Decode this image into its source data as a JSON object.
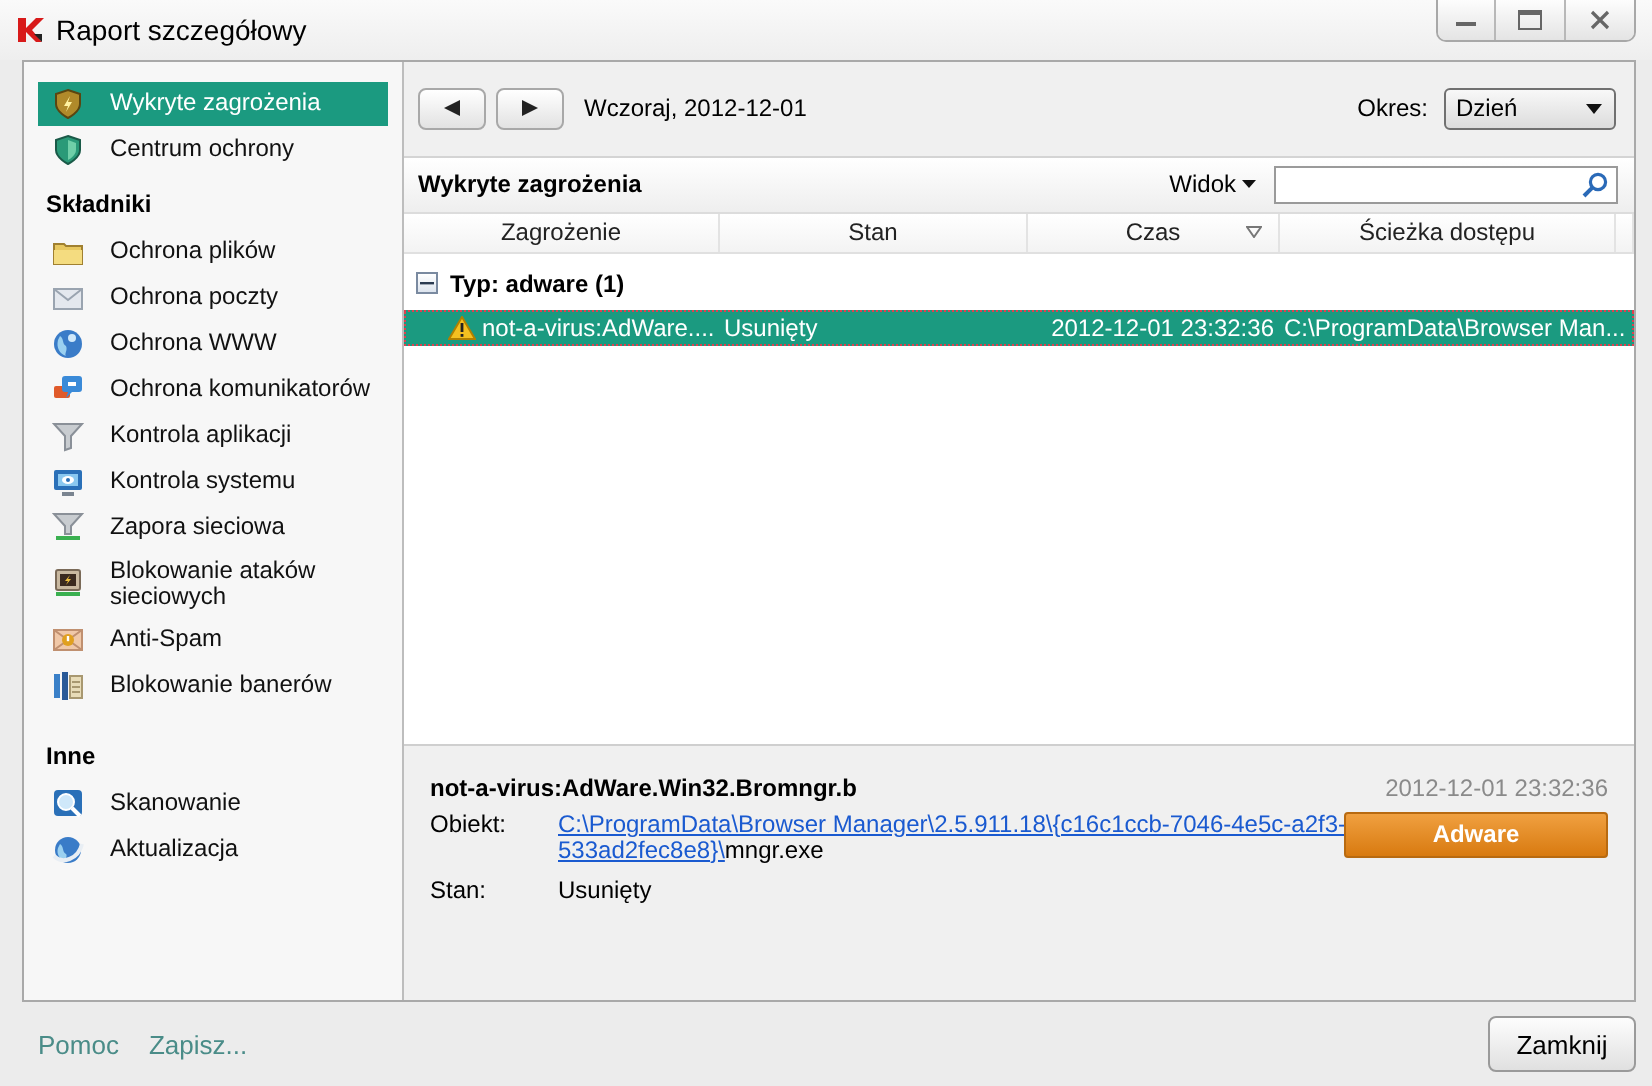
{
  "window": {
    "title": "Raport szczegółowy"
  },
  "sidebar": {
    "items": [
      {
        "label": "Wykryte zagrożenia",
        "selected": true
      },
      {
        "label": "Centrum ochrony",
        "selected": false
      }
    ],
    "sections": [
      {
        "heading": "Składniki",
        "items": [
          {
            "label": "Ochrona plików",
            "selected": false
          },
          {
            "label": "Ochrona poczty",
            "selected": false
          },
          {
            "label": "Ochrona WWW",
            "selected": false
          },
          {
            "label": "Ochrona komunikatorów",
            "selected": false
          },
          {
            "label": "Kontrola aplikacji",
            "selected": false
          },
          {
            "label": "Kontrola systemu",
            "selected": false
          },
          {
            "label": "Zapora sieciowa",
            "selected": false
          },
          {
            "label": "Blokowanie ataków sieciowych",
            "selected": false
          },
          {
            "label": "Anti-Spam",
            "selected": false
          },
          {
            "label": "Blokowanie banerów",
            "selected": false
          }
        ]
      },
      {
        "heading": "Inne",
        "items": [
          {
            "label": "Skanowanie",
            "selected": false
          },
          {
            "label": "Aktualizacja",
            "selected": false
          }
        ]
      }
    ]
  },
  "toolbar": {
    "date": "Wczoraj, 2012-12-01",
    "period_label": "Okres:",
    "period": "Dzień"
  },
  "list": {
    "title": "Wykryte zagrożenia",
    "view_menu": "Widok",
    "columns": [
      {
        "label": "Zagrożenie",
        "sorted": false
      },
      {
        "label": "Stan",
        "sorted": false
      },
      {
        "label": "Czas",
        "sorted": true
      },
      {
        "label": "Ścieżka dostępu",
        "sorted": false
      }
    ],
    "groups": [
      {
        "label": "Typ: adware (1)",
        "expanded": true,
        "rows": [
          {
            "threat": "not-a-virus:AdWare....",
            "status": "Usunięty",
            "time": "2012-12-01 23:32:36",
            "path": "C:\\ProgramData\\Browser Man...",
            "selected": true
          }
        ]
      }
    ]
  },
  "details": {
    "name": "not-a-virus:AdWare.Win32.Bromngr.b",
    "time": "2012-12-01 23:32:36",
    "object_label": "Obiekt:",
    "object_link_lines": [
      "C:\\ProgramData\\Browser Manager\\2.5.911.18\\{c16c1ccb-7046-4e5c-a2f3-",
      "533ad2fec8e8}\\"
    ],
    "object_file": "mngr.exe",
    "status_label": "Stan:",
    "status": "Usunięty",
    "category": "Adware"
  },
  "footer": {
    "links": [
      "Pomoc",
      "Zapisz..."
    ],
    "close_button": "Zamknij"
  }
}
